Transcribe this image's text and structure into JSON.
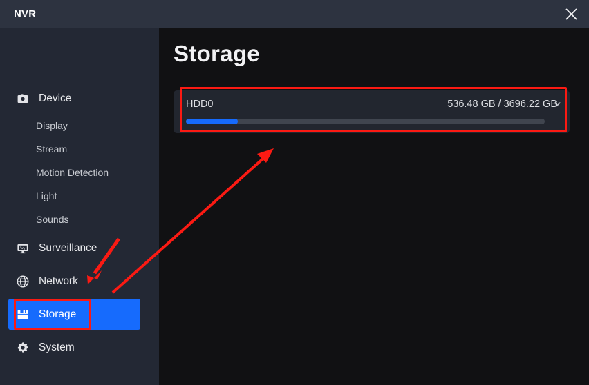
{
  "window": {
    "title": "NVR",
    "close_icon": "close-icon"
  },
  "sidebar": {
    "items": [
      {
        "label": "Device",
        "icon": "camera-icon",
        "type": "group",
        "active": false
      },
      {
        "label": "Display",
        "icon": "",
        "type": "sub",
        "active": false
      },
      {
        "label": "Stream",
        "icon": "",
        "type": "sub",
        "active": false
      },
      {
        "label": "Motion Detection",
        "icon": "",
        "type": "sub",
        "active": false
      },
      {
        "label": "Light",
        "icon": "",
        "type": "sub",
        "active": false
      },
      {
        "label": "Sounds",
        "icon": "",
        "type": "sub",
        "active": false
      },
      {
        "label": "Surveillance",
        "icon": "monitor-icon",
        "type": "group",
        "active": false
      },
      {
        "label": "Network",
        "icon": "globe-icon",
        "type": "group",
        "active": false
      },
      {
        "label": "Storage",
        "icon": "floppy-disk-icon",
        "type": "group",
        "active": true
      },
      {
        "label": "System",
        "icon": "gear-icon",
        "type": "group",
        "active": false
      }
    ]
  },
  "main": {
    "page_title": "Storage",
    "disks": [
      {
        "name": "HDD0",
        "size_text": "536.48 GB / 3696.22 GB",
        "used_gb": 536.48,
        "total_gb": 3696.22,
        "used_percent": 14.5,
        "expand_icon": "chevron-down-icon"
      }
    ]
  },
  "colors": {
    "accent_blue": "#166bfd",
    "annotation_red": "#fb1a13",
    "titlebar_bg": "#2d3340",
    "sidebar_bg": "#232834",
    "content_bg": "#111113",
    "card_bg": "#22262f",
    "progress_track": "#40454f"
  },
  "annotations": {
    "card_highlight": "red-rectangle-storage-card",
    "sidebar_highlight": "red-rectangle-storage-nav",
    "arrow_long": "red-arrow-pointing-to-storage-card",
    "arrow_short": "red-arrow-pointing-to-storage-nav"
  }
}
